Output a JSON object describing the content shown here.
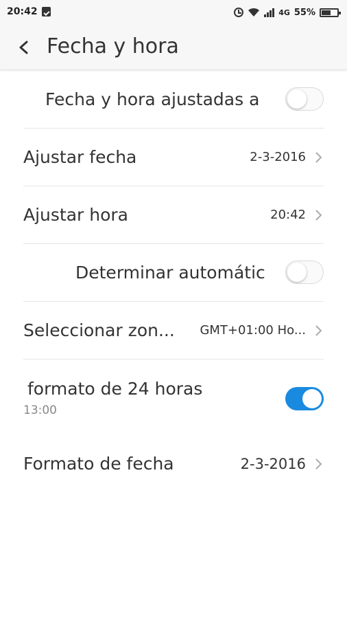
{
  "status": {
    "time": "20:42",
    "network": "4G",
    "battery": "55%"
  },
  "header": {
    "title": "Fecha y hora"
  },
  "settings": {
    "auto_datetime": {
      "label": "Fecha y hora ajustadas a",
      "enabled": false
    },
    "set_date": {
      "label": "Ajustar fecha",
      "value": "2-3-2016"
    },
    "set_time": {
      "label": "Ajustar hora",
      "value": "20:42"
    },
    "auto_timezone": {
      "label": "Determinar automátic",
      "enabled": false
    },
    "timezone": {
      "label": "Seleccionar zon...",
      "value": "GMT+01:00 Ho..."
    },
    "format24": {
      "label": "formato de 24 horas",
      "sublabel": "13:00",
      "enabled": true
    },
    "date_format": {
      "label": "Formato de fecha",
      "value": "2-3-2016"
    }
  },
  "colors": {
    "toggle_on": "#1a8ae0"
  }
}
